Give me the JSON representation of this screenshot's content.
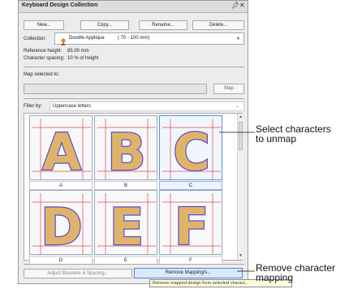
{
  "window": {
    "title": "Keyboard Design Collection"
  },
  "toolbar": {
    "new_label": "New...",
    "copy_label": "Copy...",
    "rename_label": "Rename...",
    "delete_label": "Delete..."
  },
  "collection": {
    "label": "Collection:",
    "name": "Doodle Applique",
    "range": "( 70 - 100 mm)"
  },
  "reference_height": {
    "label": "Reference height:",
    "value": "85.00 mm"
  },
  "character_spacing": {
    "label": "Character spacing:",
    "value": "10 % of height"
  },
  "map": {
    "label": "Map selected to:",
    "button_label": "Map",
    "value": ""
  },
  "filter": {
    "label": "Filter by:",
    "value": "Uppercase letters"
  },
  "characters": [
    {
      "letter": "A",
      "caption": "A"
    },
    {
      "letter": "B",
      "caption": "B"
    },
    {
      "letter": "C",
      "caption": "C"
    },
    {
      "letter": "D",
      "caption": "D"
    },
    {
      "letter": "E",
      "caption": "E"
    },
    {
      "letter": "F",
      "caption": "F"
    }
  ],
  "bottom": {
    "adjust_label": "Adjust Baseline & Spacing...",
    "remove_label": "Remove Mapping/s..."
  },
  "tooltip": {
    "text": "Remove mapped design from selected charact..."
  },
  "callouts": {
    "select_line1": "Select characters",
    "select_line2": "to unmap",
    "remove_line1": "Remove character",
    "remove_line2": "mapping"
  },
  "colors": {
    "fill": "#e0b36a",
    "outline": "#5a4fc7",
    "guide": "#e04848",
    "selection": "#5a8fd6"
  }
}
